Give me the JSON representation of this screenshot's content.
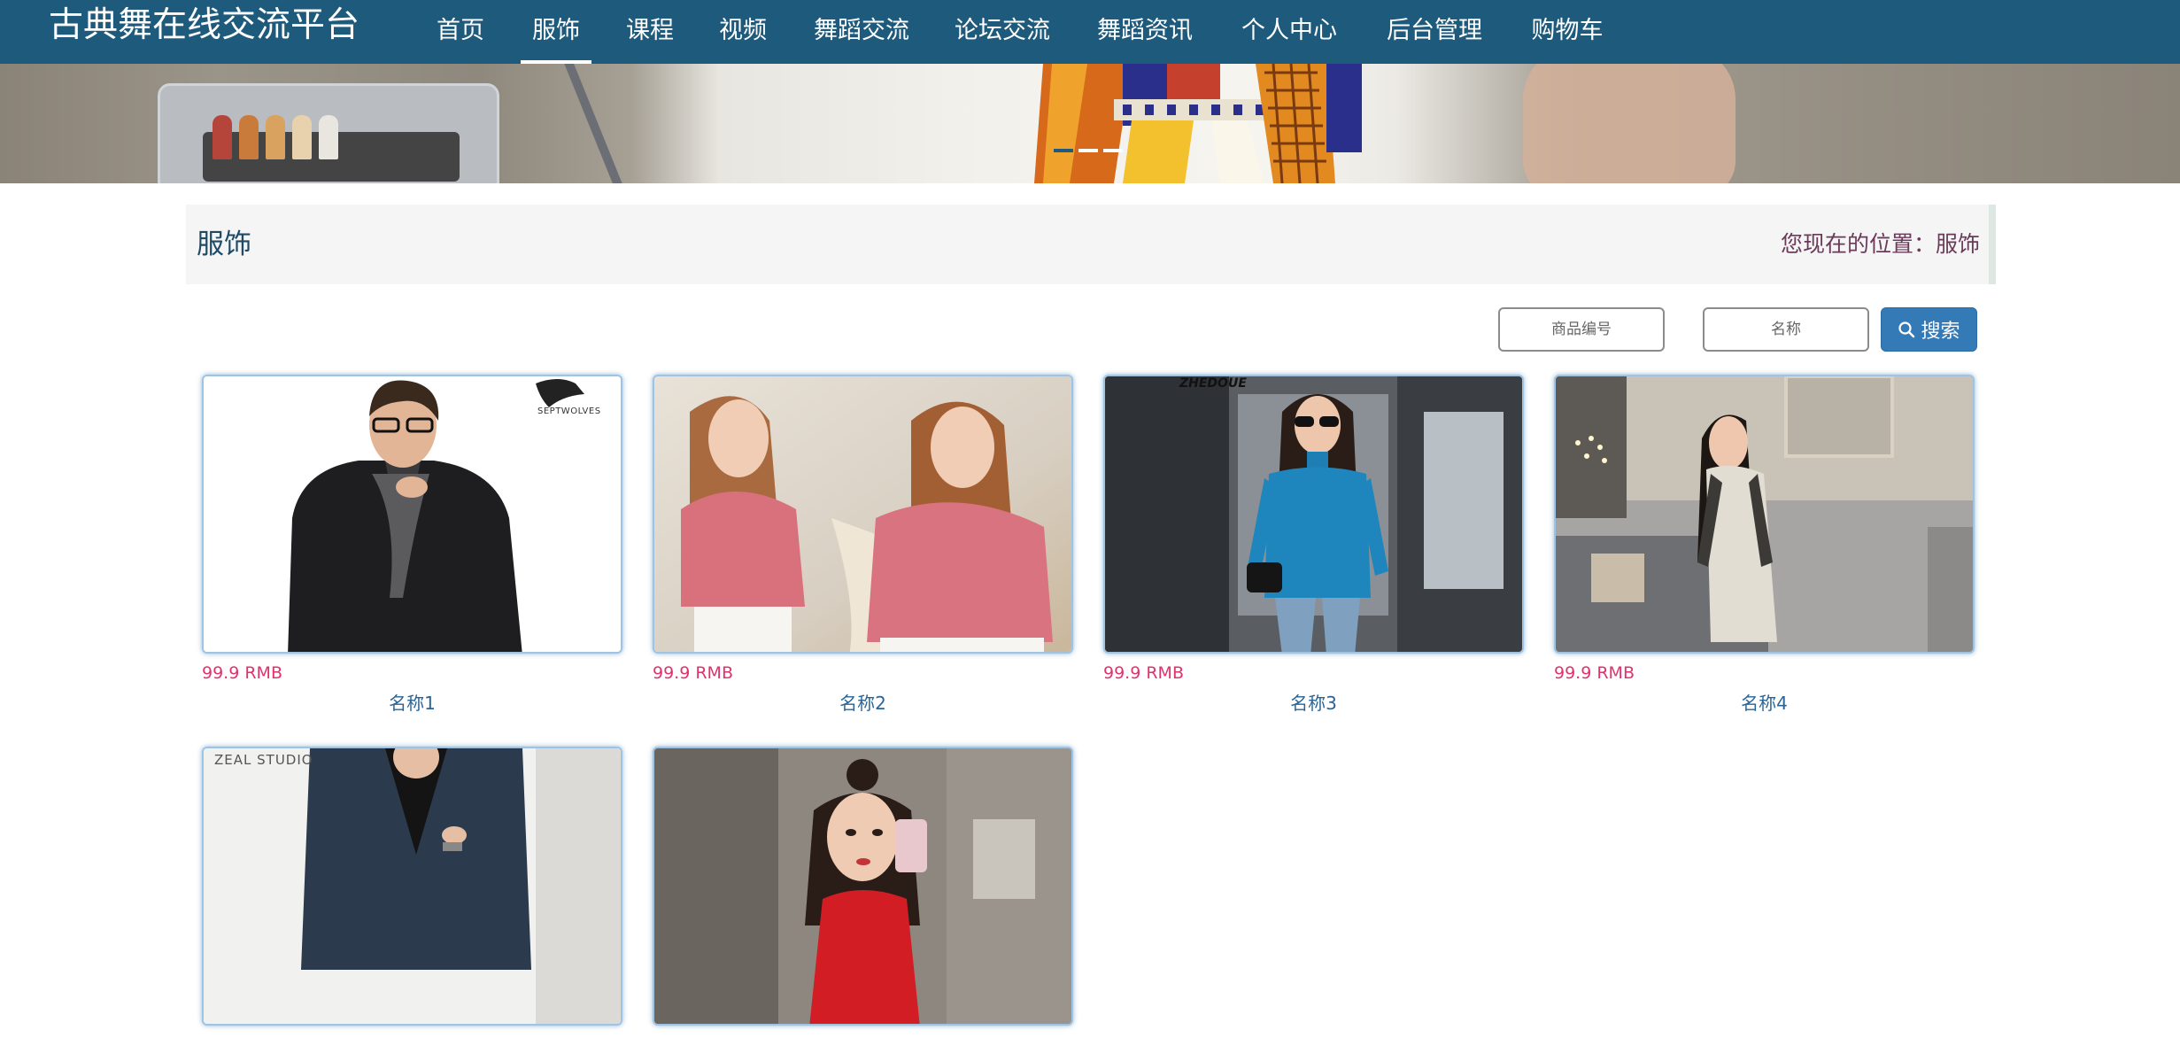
{
  "app": {
    "brand": "古典舞在线交流平台"
  },
  "nav": {
    "items": [
      {
        "label": "首页"
      },
      {
        "label": "服饰",
        "active": true
      },
      {
        "label": "课程"
      },
      {
        "label": "视频"
      },
      {
        "label": "舞蹈交流"
      },
      {
        "label": "论坛交流"
      },
      {
        "label": "舞蹈资讯"
      },
      {
        "label": "个人中心"
      },
      {
        "label": "后台管理"
      },
      {
        "label": "购物车"
      }
    ]
  },
  "section": {
    "title": "服饰",
    "location_label": "您现在的位置：",
    "location_value": "服饰"
  },
  "search": {
    "code_placeholder": "商品编号",
    "name_placeholder": "名称",
    "button_label": "搜索",
    "button_icon": "search-icon"
  },
  "products": [
    {
      "price": "99.9 RMB",
      "name": "名称1",
      "logo_text": "SEPTWOLVES"
    },
    {
      "price": "99.9 RMB",
      "name": "名称2"
    },
    {
      "price": "99.9 RMB",
      "name": "名称3",
      "logo_text": "ZHEDOUE"
    },
    {
      "price": "99.9 RMB",
      "name": "名称4"
    },
    {
      "price": "",
      "name": "",
      "logo_text": "ZEAL STUDIO"
    },
    {
      "price": "",
      "name": ""
    }
  ],
  "colors": {
    "nav_bg": "#1e5a7c",
    "accent": "#337ab7",
    "price": "#e0336d",
    "link": "#2a6496"
  }
}
